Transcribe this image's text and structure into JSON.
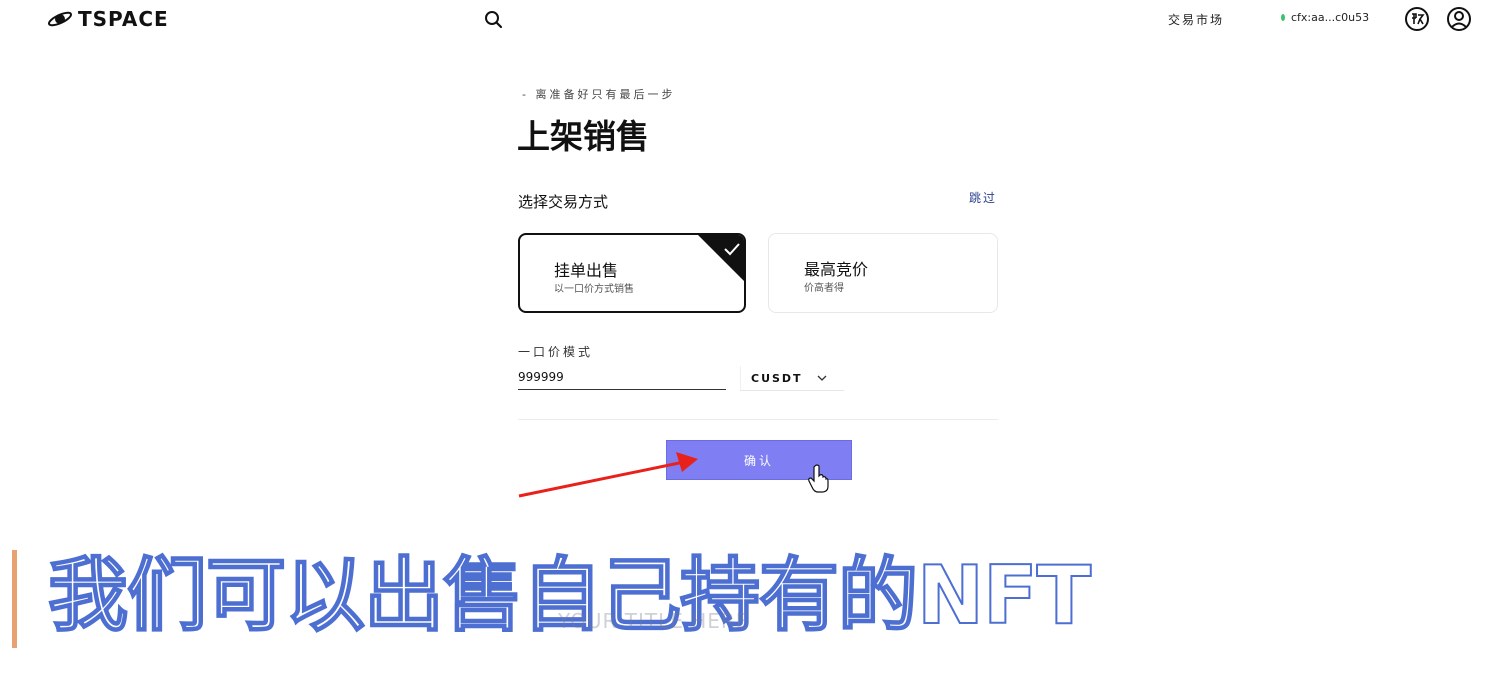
{
  "header": {
    "logo_text": "TSPACE",
    "nav_market": "交易市场",
    "wallet_address": "cfx:aa...c0u53",
    "icons": [
      "planet-logo-icon",
      "search-icon",
      "language-icon",
      "user-icon"
    ]
  },
  "form": {
    "breadcrumb": "- 离准备好只有最后一步",
    "title": "上架销售",
    "section_label": "选择交易方式",
    "skip_label": "跳过",
    "options": [
      {
        "title": "挂单出售",
        "subtitle": "以一口价方式销售",
        "selected": true
      },
      {
        "title": "最高竞价",
        "subtitle": "价高者得",
        "selected": false
      }
    ],
    "mode_label": "一口价模式",
    "price_value": "999999",
    "currency": "CUSDT",
    "confirm_label": "确认"
  },
  "overlay": {
    "subtitle": "我们可以出售自己持有的NFT",
    "watermark": "YOUR TITLE HERE"
  },
  "colors": {
    "accent": "#7f7ef3",
    "link": "#2a3f8f",
    "arrow": "#e8221b",
    "subtitle_outline": "#4e6fd2",
    "subtitle_bar": "#e8a172",
    "wallet_dot": "#3cc26e"
  }
}
